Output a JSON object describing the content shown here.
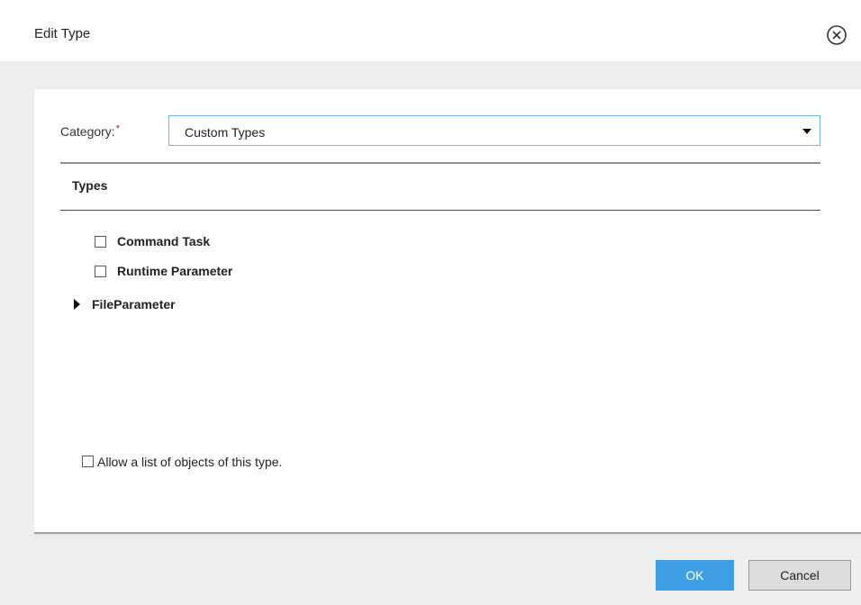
{
  "dialog": {
    "title": "Edit Type",
    "close_icon": "close-circle-icon"
  },
  "form": {
    "category_label": "Category:",
    "required_marker": "*",
    "category_value": "Custom Types",
    "types_header": "Types",
    "types": [
      {
        "label": "Command Task",
        "checked": false
      },
      {
        "label": "Runtime Parameter",
        "checked": false
      }
    ],
    "group": {
      "label": "FileParameter",
      "expanded": false,
      "icon": "caret-right-icon"
    },
    "allow_list_label": "Allow a list of objects of this type.",
    "allow_list_checked": false
  },
  "buttons": {
    "ok_label": "OK",
    "cancel_label": "Cancel"
  },
  "colors": {
    "primary": "#3f9fe6",
    "focus_border": "#73b8e8",
    "required": "#d0021b",
    "backdrop": "#eeeeee"
  }
}
